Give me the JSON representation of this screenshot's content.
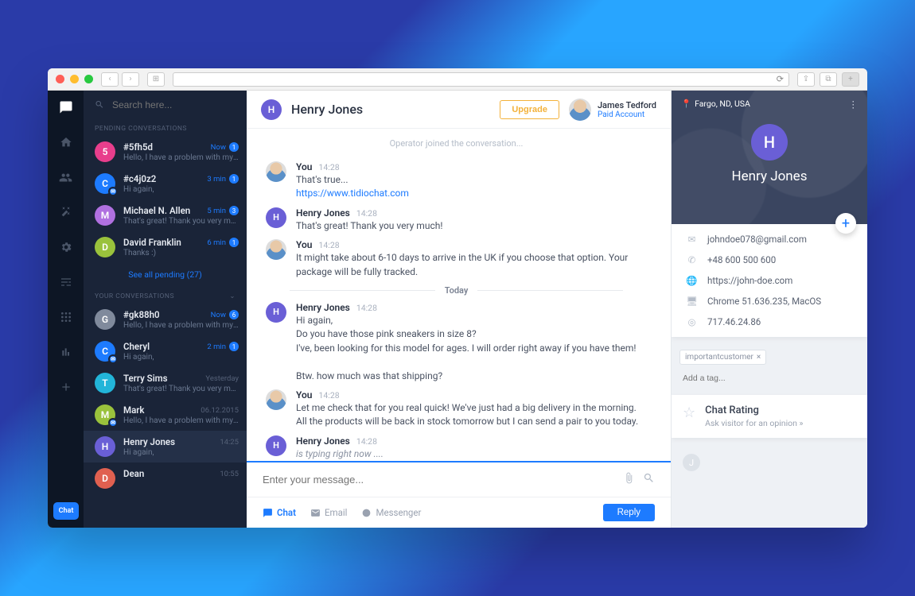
{
  "chrome": {
    "reload_icon": "⟳",
    "share_icon": "⇪",
    "copy_icon": "⧉",
    "plus_icon": "+"
  },
  "search": {
    "placeholder": "Search here..."
  },
  "sections": {
    "pending": "PENDING CONVERSATIONS",
    "your": "YOUR CONVERSATIONS",
    "see_all": "See all pending (27)"
  },
  "pending": [
    {
      "name": "#5fh5d",
      "time": "Now",
      "badge": "1",
      "snippet": "Hello, I have a problem with my wid...",
      "initial": "5",
      "color": "#e83e8c"
    },
    {
      "name": "#c4j0z2",
      "time": "3 min",
      "badge": "1",
      "snippet": "Hi again,",
      "initial": "C",
      "color": "#1d7bff",
      "sub": true
    },
    {
      "name": "Michael N. Allen",
      "time": "5 min",
      "badge": "3",
      "snippet": "That's great! Thank you very much!",
      "initial": "M",
      "color": "#b070e0"
    },
    {
      "name": "David Franklin",
      "time": "6 min",
      "badge": "1",
      "snippet": "Thanks :)",
      "initial": "D",
      "color": "#9ac23c"
    }
  ],
  "your": [
    {
      "name": "#gk88h0",
      "time": "Now",
      "badge": "6",
      "time_cls": "",
      "snippet": "Hello, I have a problem with my wid...",
      "initial": "G",
      "color": "#808a9c"
    },
    {
      "name": "Cheryl",
      "time": "2 min",
      "badge": "1",
      "time_cls": "",
      "snippet": "Hi again,",
      "initial": "C",
      "color": "#1d7bff",
      "sub": true
    },
    {
      "name": "Terry Sims",
      "time": "Yesterday",
      "time_cls": "muted",
      "snippet": "That's great! Thank you very much!",
      "initial": "T",
      "color": "#22b5d9"
    },
    {
      "name": "Mark",
      "time": "06.12.2015",
      "time_cls": "muted",
      "snippet": "Hello, I have a problem with my wid...",
      "initial": "M",
      "color": "#9ac23c",
      "sub": true
    },
    {
      "name": "Henry Jones",
      "time": "14:25",
      "time_cls": "muted",
      "snippet": "Hi again,",
      "initial": "H",
      "color": "#6a5fd6",
      "selected": true
    },
    {
      "name": "Dean",
      "time": "10:55",
      "time_cls": "muted",
      "snippet": "",
      "initial": "D",
      "color": "#e06050"
    }
  ],
  "header": {
    "title": "Henry Jones",
    "avatar_initial": "H",
    "upgrade": "Upgrade",
    "me_name": "James Tedford",
    "me_sub": "Paid Account"
  },
  "chat": {
    "system": "Operator joined the conversation...",
    "divider": "Today",
    "messages_pre": [
      {
        "author": "You",
        "time": "14:28",
        "avatar": "op",
        "text": "That's true...",
        "link": "https://www.tidiochat.com"
      },
      {
        "author": "Henry Jones",
        "time": "14:28",
        "avatar": "H",
        "text": "That's great! Thank you very much!"
      },
      {
        "author": "You",
        "time": "14:28",
        "avatar": "op",
        "text": "It might take about 6-10 days to arrive in the UK if you choose that option. Your package will be fully tracked."
      }
    ],
    "messages_post": [
      {
        "author": "Henry Jones",
        "time": "14:28",
        "avatar": "H",
        "text": "Hi again,\nDo you have those pink sneakers in size 8?\nI've, been looking for this model for ages. I will order right away if you have them!\n\nBtw. how much was that shipping?"
      },
      {
        "author": "You",
        "time": "14:28",
        "avatar": "op",
        "text": "Let me check that for you real quick! We've just had a big delivery in the morning. All the products will be back in stock tomorrow but I can send a pair to you today."
      },
      {
        "author": "Henry Jones",
        "time": "14:28",
        "avatar": "H",
        "text": "is typing right now ....",
        "italic": true
      }
    ]
  },
  "composer": {
    "placeholder": "Enter your message...",
    "tab_chat": "Chat",
    "tab_email": "Email",
    "tab_messenger": "Messenger",
    "reply": "Reply"
  },
  "visitor": {
    "location": "Fargo, ND, USA",
    "name": "Henry Jones",
    "avatar_initial": "H",
    "email": "johndoe078@gmail.com",
    "phone": "+48 600 500 600",
    "site": "https://john-doe.com",
    "browser": "Chrome 51.636.235, MacOS",
    "ip": "717.46.24.86",
    "tag": "importantcustomer",
    "tag_placeholder": "Add a tag...",
    "rating_title": "Chat Rating",
    "rating_sub": "Ask visitor for an opinion »",
    "ghost": "J"
  },
  "rail_badge": "Chat"
}
